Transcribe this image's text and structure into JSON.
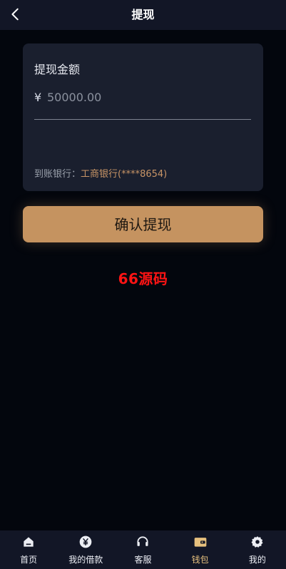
{
  "header": {
    "title": "提现",
    "back_icon": "chevron-left-icon"
  },
  "withdraw": {
    "amount_label": "提现金额",
    "currency_symbol": "¥",
    "amount_placeholder": "50000.00",
    "amount_value": "",
    "bank_label": "到账银行：",
    "bank_value": "工商银行(****8654)"
  },
  "actions": {
    "confirm_label": "确认提现"
  },
  "watermark": {
    "text": "66源码"
  },
  "tabbar": {
    "active": "wallet",
    "items": [
      {
        "key": "home",
        "label": "首页",
        "icon": "home-icon"
      },
      {
        "key": "loans",
        "label": "我的借款",
        "icon": "yen-icon"
      },
      {
        "key": "service",
        "label": "客服",
        "icon": "headset-icon"
      },
      {
        "key": "wallet",
        "label": "钱包",
        "icon": "wallet-icon"
      },
      {
        "key": "mine",
        "label": "我的",
        "icon": "settings-icon"
      }
    ]
  },
  "colors": {
    "page_bg": "#03060d",
    "header_bg": "#121626",
    "card_bg": "#1a1f2e",
    "accent": "#c59360",
    "bank_text": "#c99566",
    "watermark": "#ff1414",
    "tab_active": "#e6c07e"
  }
}
